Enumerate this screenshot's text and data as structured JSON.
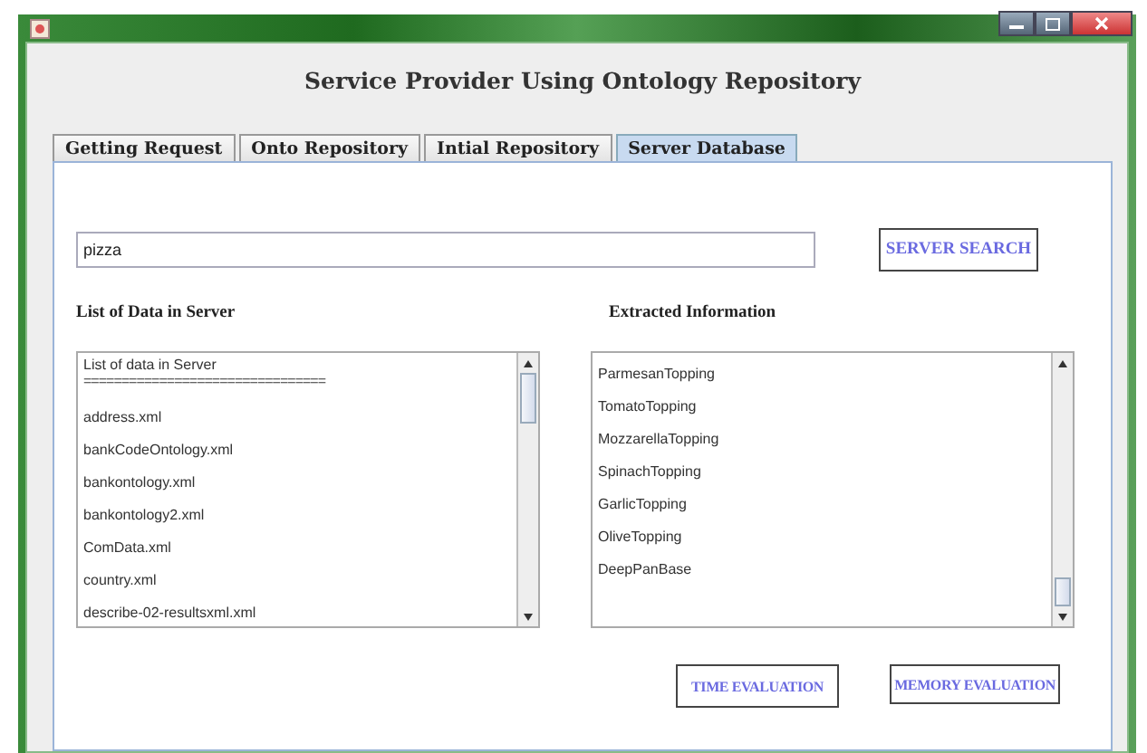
{
  "window": {
    "title": "Service Provider Using Ontology Repository"
  },
  "tabs": [
    {
      "label": "Getting Request",
      "selected": false
    },
    {
      "label": "Onto Repository",
      "selected": false
    },
    {
      "label": "Intial Repository",
      "selected": false
    },
    {
      "label": "Server Database",
      "selected": true
    }
  ],
  "search": {
    "value": "pizza",
    "button": "SERVER SEARCH"
  },
  "server_list": {
    "heading": "List of Data in Server",
    "items": [
      "List of data in Server",
      "================================",
      "address.xml",
      "bankCodeOntology.xml",
      "bankontology.xml",
      "bankontology2.xml",
      "ComData.xml",
      "country.xml",
      "describe-02-resultsxml.xml"
    ]
  },
  "extracted": {
    "heading": "Extracted Information",
    "items": [
      "ParmesanTopping",
      "TomatoTopping",
      "MozzarellaTopping",
      "SpinachTopping",
      "GarlicTopping",
      "OliveTopping",
      "DeepPanBase"
    ]
  },
  "buttons": [
    "TIME EVALUATION",
    "MEMORY EVALUATION"
  ]
}
